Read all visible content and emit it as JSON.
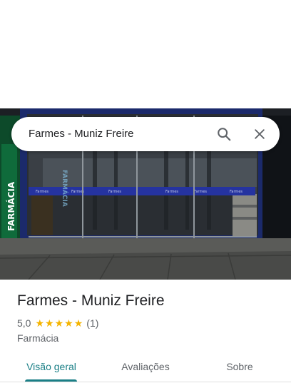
{
  "search": {
    "query": "Farmes - Muniz Freire"
  },
  "photo": {
    "sign_text": "FARMÁCIA",
    "window_brand": "Farmes"
  },
  "place": {
    "name": "Farmes - Muniz Freire",
    "rating": "5,0",
    "stars": 5,
    "review_count": "(1)",
    "category": "Farmácia"
  },
  "tabs": [
    {
      "label": "Visão geral",
      "active": true
    },
    {
      "label": "Avaliações",
      "active": false
    },
    {
      "label": "Sobre",
      "active": false
    }
  ],
  "colors": {
    "accent": "#1a7f86",
    "star": "#f4b400"
  }
}
